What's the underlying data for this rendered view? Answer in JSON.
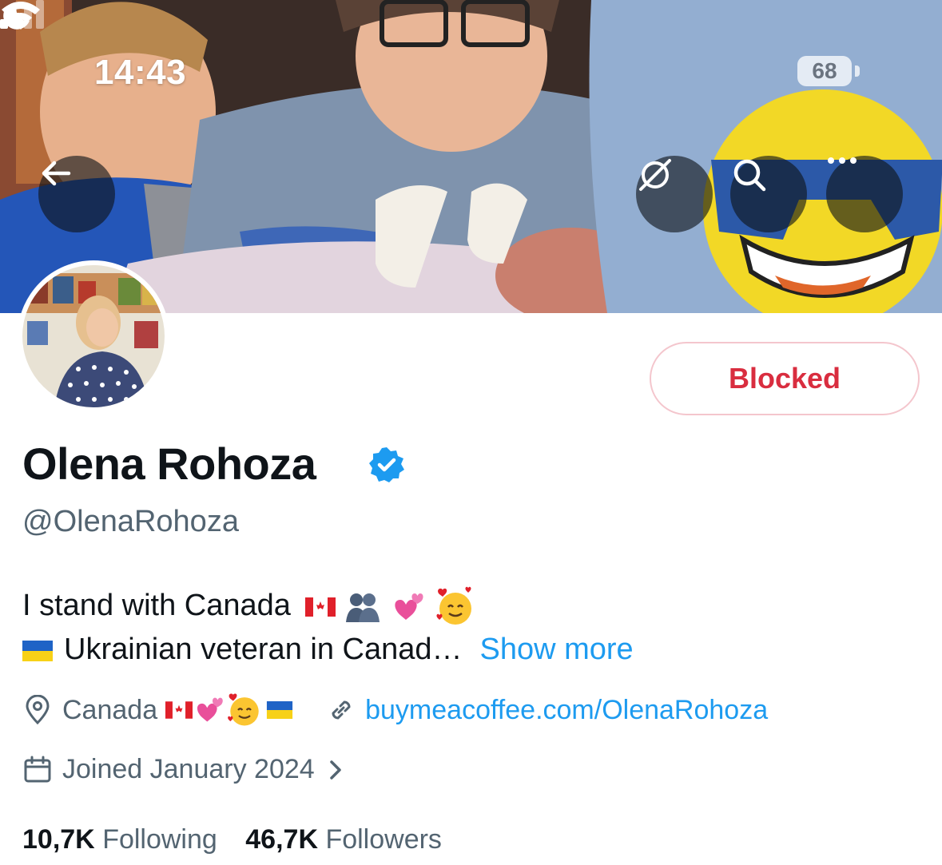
{
  "status_bar": {
    "time": "14:43",
    "battery": "68"
  },
  "profile": {
    "action_button": "Blocked",
    "display_name": "Olena Rohoza",
    "handle": "@OlenaRohoza",
    "bio_line1": "I stand with Canada",
    "bio_line2": "Ukrainian veteran in Canad…",
    "show_more": "Show more",
    "location": "Canada",
    "website": "buymeacoffee.com/OlenaRohoza",
    "joined": "Joined January 2024",
    "following_count": "10,7K",
    "following_label": "Following",
    "followers_count": "46,7K",
    "followers_label": "Followers"
  },
  "icons": {
    "back": "arrow-left-icon",
    "translate": "globe-slash-icon",
    "search": "search-icon",
    "more": "more-icon",
    "verified": "verified-badge-icon",
    "location": "location-pin-icon",
    "link": "link-icon",
    "calendar": "calendar-icon",
    "chevron": "chevron-right-icon"
  },
  "colors": {
    "accent": "#1d9bf0",
    "blocked_text": "#d92d3f",
    "blocked_border": "#f4c6cd",
    "secondary_text": "#536471"
  }
}
